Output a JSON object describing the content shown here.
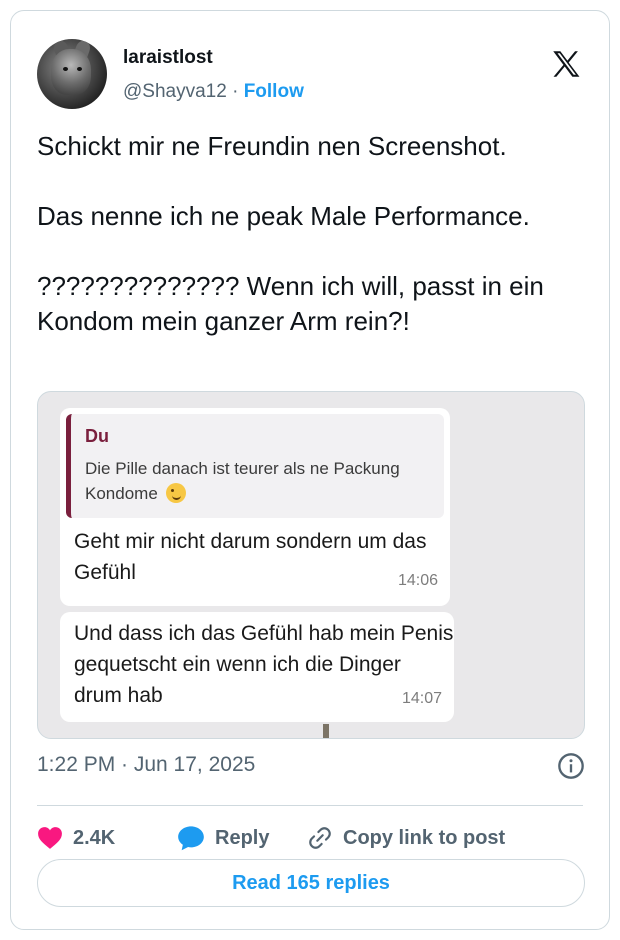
{
  "header": {
    "display_name": "laraistlost",
    "handle": "@Shayva12",
    "separator": "·",
    "follow_label": "Follow"
  },
  "tweet": {
    "text": "Schickt mir ne Freundin nen Screenshot.\n\nDas nenne ich ne peak Male Performance.\n\n?????????????? Wenn ich will, passt in ein Kondom mein ganzer Arm rein?!"
  },
  "media": {
    "quoted_author": "Du",
    "quoted_text": "Die Pille danach ist teurer als ne Packung Kondome",
    "message1": "Geht mir nicht darum sondern um das Gefühl",
    "time1": "14:06",
    "message2": "Und dass ich das Gefühl hab mein Penis gequetscht ein wenn ich die Dinger drum hab",
    "time2": "14:07"
  },
  "meta": {
    "timestamp": "1:22 PM · Jun 17, 2025"
  },
  "actions": {
    "like_count": "2.4K",
    "reply_label": "Reply",
    "copy_label": "Copy link to post",
    "read_replies_label": "Read 165 replies"
  },
  "colors": {
    "accent": "#1d9bf0",
    "like": "#f91880",
    "quote_bar": "#7a1f3d"
  }
}
